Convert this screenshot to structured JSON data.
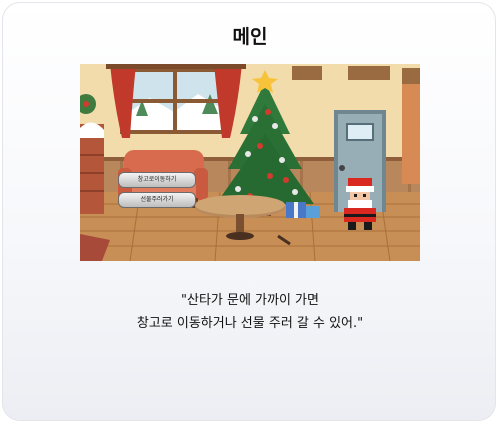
{
  "page": {
    "title": "메인"
  },
  "game": {
    "buttons": [
      {
        "label": "창고로이동하기"
      },
      {
        "label": "선물주러가기"
      }
    ]
  },
  "caption": {
    "line1": "\"산타가 문에 가까이 가면",
    "line2": "창고로 이동하거나 선물 주러 갈 수 있어.\""
  }
}
